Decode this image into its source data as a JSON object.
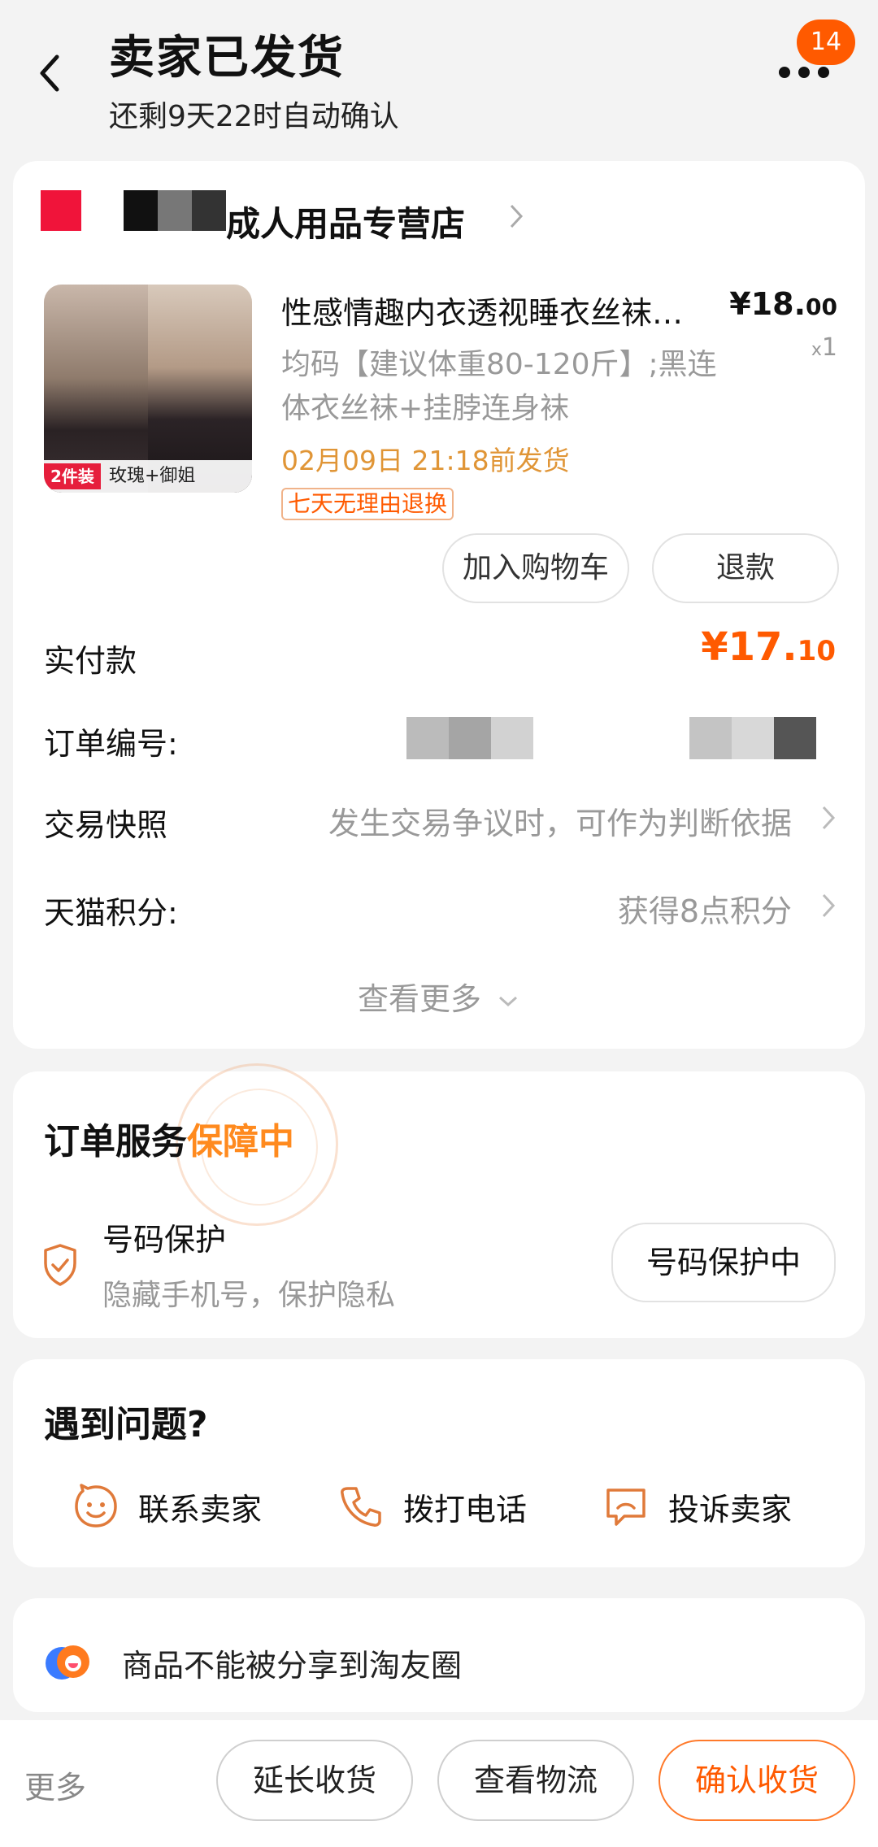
{
  "header": {
    "title": "卖家已发货",
    "subtitle": "还剩9天22时自动确认",
    "badge_count": "14"
  },
  "shop": {
    "name": "成人用品专营店",
    "logo_color": "#f0143a"
  },
  "product": {
    "title": "性感情趣内衣透视睡衣丝袜…",
    "price_main": "¥18.",
    "price_decimal": "00",
    "qty_prefix": "x",
    "qty": "1",
    "sku": "均码【建议体重80-120斤】;黑连体衣丝袜+挂脖连身袜",
    "ship_by": "02月09日 21:18前发货",
    "return_tag": "七天无理由退换",
    "image_tag_badge": "2件装",
    "image_tag_text": "玫瑰+御姐"
  },
  "actions": {
    "add_cart": "加入购物车",
    "refund": "退款"
  },
  "rows": {
    "paid_label": "实付款",
    "paid_main": "¥17.",
    "paid_decimal": "10",
    "order_no_label": "订单编号:",
    "snapshot_label": "交易快照",
    "snapshot_value": "发生交易争议时，可作为判断依据",
    "points_label": "天猫积分:",
    "points_value": "获得8点积分",
    "see_more": "查看更多"
  },
  "service": {
    "title": "订单服务",
    "title_highlight": "保障中",
    "item_name": "号码保护",
    "item_desc": "隐藏手机号，保护隐私",
    "item_button": "号码保护中"
  },
  "problems": {
    "title": "遇到问题?",
    "contact_seller": "联系卖家",
    "call": "拨打电话",
    "complain": "投诉卖家"
  },
  "share": {
    "text": "商品不能被分享到淘友圈"
  },
  "bottom": {
    "more": "更多",
    "extend": "延长收货",
    "logistics": "查看物流",
    "confirm": "确认收货"
  },
  "colors": {
    "accent": "#ff5a00",
    "highlight": "#ff8a1e",
    "ship_text": "#e09536"
  },
  "icons": [
    "back-icon",
    "more-icon",
    "chevron-right-icon",
    "shield-check-icon",
    "chat-smile-icon",
    "phone-icon",
    "complaint-icon",
    "share-circle-icon",
    "chevron-down-icon"
  ]
}
